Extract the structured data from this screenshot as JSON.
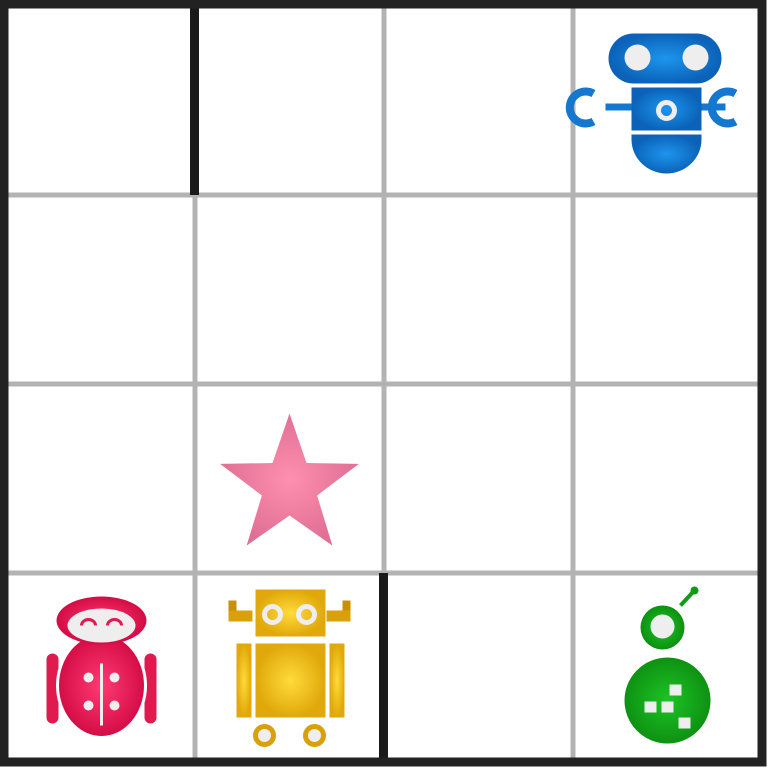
{
  "board": {
    "rows": 4,
    "cols": 4,
    "colors": {
      "frame": "#222222",
      "grid": "#b3b3b3",
      "wall": "#1a1a1a",
      "background": "#ffffff",
      "face": "#eeeeee"
    },
    "walls": [
      {
        "type": "vertical",
        "row": 0,
        "between_cols": [
          0,
          1
        ]
      },
      {
        "type": "vertical",
        "row": 3,
        "between_cols": [
          1,
          2
        ]
      }
    ]
  },
  "pieces": {
    "blue_robot": {
      "icon": "blue-robot-icon",
      "row": 0,
      "col": 3,
      "color": "#1a7fd6"
    },
    "red_robot": {
      "icon": "red-robot-icon",
      "row": 3,
      "col": 0,
      "color": "#e8215a"
    },
    "yellow_robot": {
      "icon": "yellow-robot-icon",
      "row": 3,
      "col": 1,
      "color": "#f5c218"
    },
    "green_robot": {
      "icon": "green-robot-icon",
      "row": 3,
      "col": 3,
      "color": "#16a81c"
    },
    "target_star": {
      "icon": "star-icon",
      "row": 2,
      "col": 1,
      "color": "#f08aa8"
    }
  }
}
